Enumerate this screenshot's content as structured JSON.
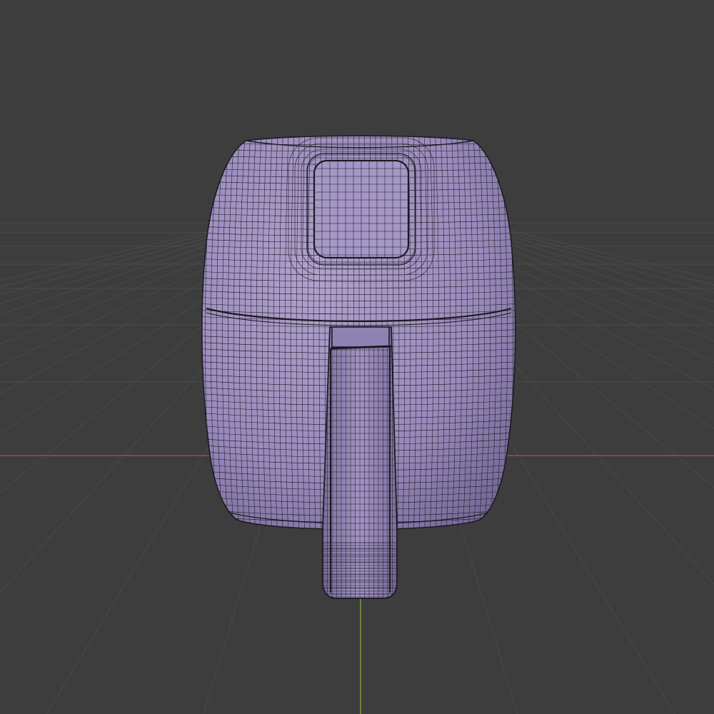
{
  "viewport": {
    "background": "#3d3d3d",
    "grid_color": "#4a4a4a",
    "x_axis_color": "#c9424f",
    "y_axis_color": "#8fb03a",
    "object": {
      "name": "air-fryer-mesh",
      "fill_color": "#9c8cba",
      "wire_color": "#1c1a22",
      "shading": "wireframe-overlay"
    }
  }
}
